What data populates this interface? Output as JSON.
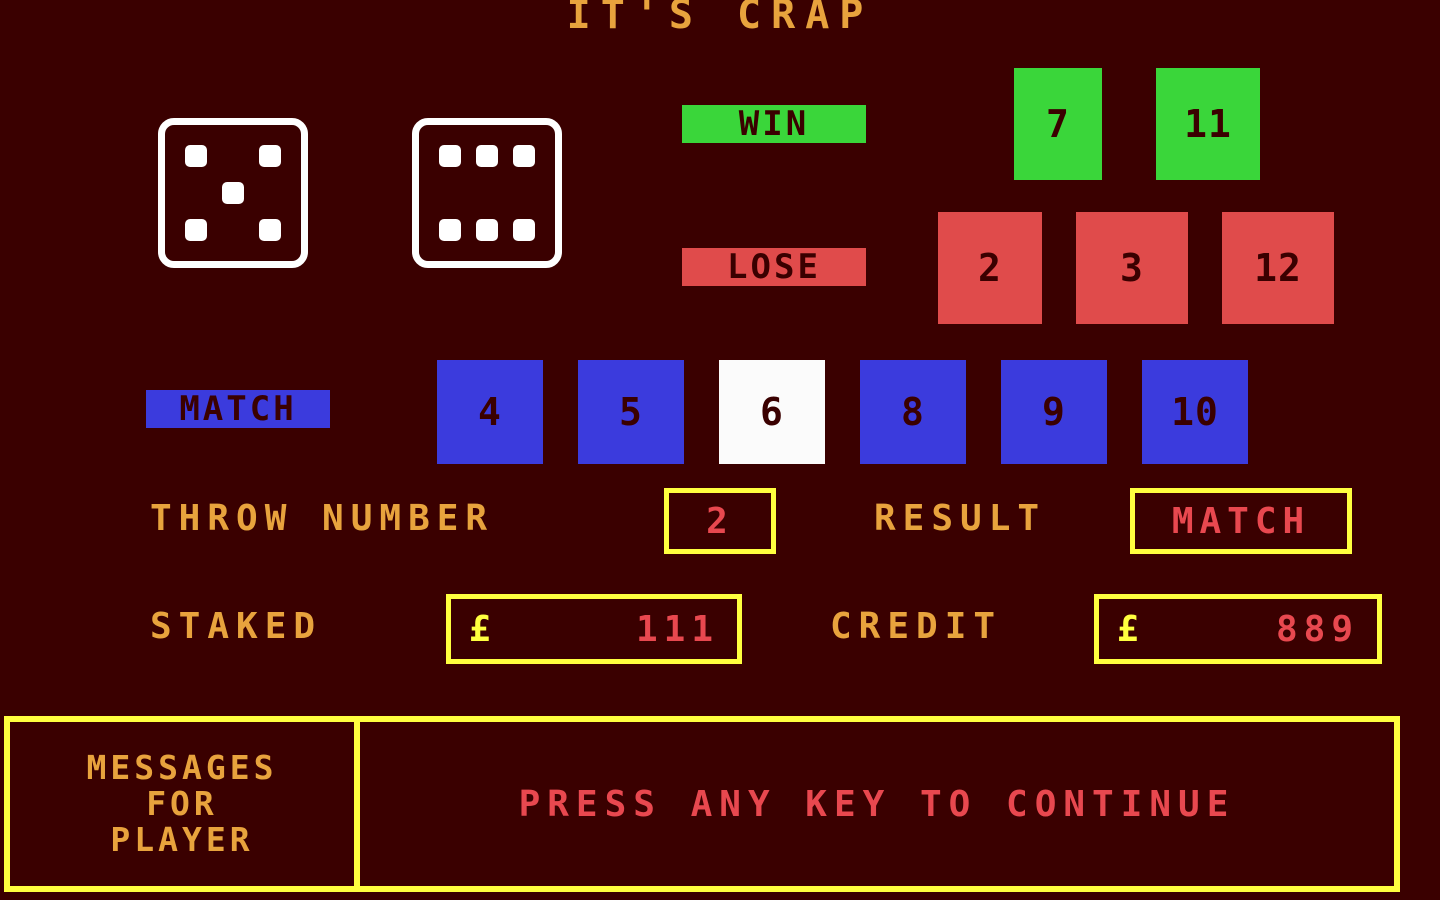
{
  "app": {
    "title": "IT'S CRAP",
    "background_color": "#3a0000"
  },
  "colors": {
    "background": "#3a0000",
    "title_text": "#e8a33d",
    "label_text": "#e8a33d",
    "value_text": "#e8484f",
    "box_border": "#ffff3f",
    "currency": "#ffff3f",
    "win_green": "#3ad63a",
    "lose_red": "#e04b4b",
    "match_blue": "#3b3bdd",
    "match_hit_white": "#fbfbfb",
    "dice_outline": "#ffffff",
    "tile_digit": "#3a0000"
  },
  "dice": {
    "icon": "dice-icon",
    "die1": {
      "label": "die-one",
      "value": 5,
      "pips": [
        1,
        0,
        1,
        0,
        1,
        0,
        1,
        0,
        1
      ]
    },
    "die2": {
      "label": "die-two",
      "value": 6,
      "pips": [
        1,
        1,
        1,
        0,
        0,
        0,
        1,
        1,
        1
      ]
    }
  },
  "outcomes": {
    "win": {
      "label": "WIN",
      "tiles": [
        "7",
        "11"
      ]
    },
    "lose": {
      "label": "LOSE",
      "tiles": [
        "2",
        "3",
        "12"
      ]
    },
    "match": {
      "label": "MATCH",
      "tiles": [
        {
          "value": "4",
          "highlighted": false
        },
        {
          "value": "5",
          "highlighted": false
        },
        {
          "value": "6",
          "highlighted": true
        },
        {
          "value": "8",
          "highlighted": false
        },
        {
          "value": "9",
          "highlighted": false
        },
        {
          "value": "10",
          "highlighted": false
        }
      ]
    }
  },
  "stats": {
    "throw_number_label": "THROW NUMBER",
    "throw_number_value": "2",
    "result_label": "RESULT",
    "result_value": "MATCH",
    "staked_label": "STAKED",
    "staked_currency": "£",
    "staked_value": "111",
    "credit_label": "CREDIT",
    "credit_currency": "£",
    "credit_value": "889"
  },
  "messages": {
    "title_line1": "MESSAGES",
    "title_line2": "FOR",
    "title_line3": "PLAYER",
    "body": "PRESS ANY KEY TO CONTINUE"
  }
}
